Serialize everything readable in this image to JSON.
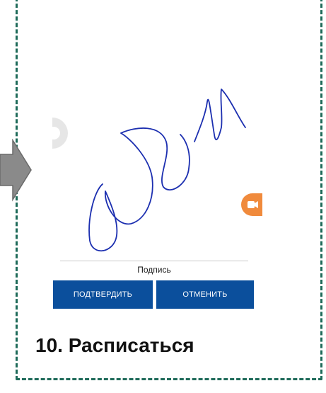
{
  "signature_pad": {
    "caption": "Подпись"
  },
  "buttons": {
    "confirm_label": "ПОДТВЕРДИТЬ",
    "cancel_label": "ОТМЕНИТЬ"
  },
  "step": {
    "title": "10. Расписаться"
  },
  "colors": {
    "frame": "#1f6b5a",
    "button": "#0b4f9c",
    "ink": "#1c2fb0",
    "arrow": "#8a8a8a",
    "accent_disc": "#f08a3c"
  },
  "icons": {
    "arrow": "right-arrow-icon",
    "left_disc": "camera-shutter-icon",
    "right_disc": "video-icon"
  }
}
